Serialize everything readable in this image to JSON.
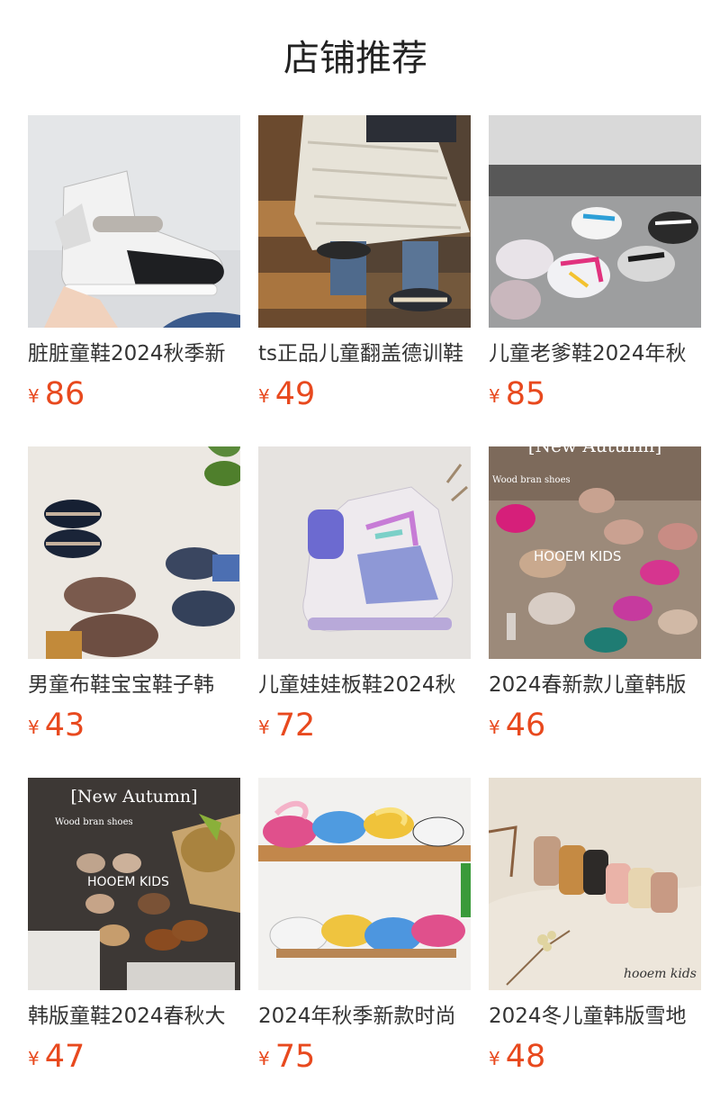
{
  "section": {
    "title": "店铺推荐"
  },
  "colors": {
    "price": "#e8491e",
    "text": "#333333"
  },
  "products": [
    {
      "name": "脏脏童鞋2024秋季新",
      "currency": "¥",
      "price": "86",
      "image": "high-top-sneaker-photo"
    },
    {
      "name": "ts正品儿童翻盖德训鞋",
      "currency": "¥",
      "price": "49",
      "image": "child-on-stairs-photo"
    },
    {
      "name": "儿童老爹鞋2024年秋",
      "currency": "¥",
      "price": "85",
      "image": "chunky-sneakers-photo"
    },
    {
      "name": "男童布鞋宝宝鞋子韩",
      "currency": "¥",
      "price": "43",
      "image": "cloth-shoes-photo"
    },
    {
      "name": "儿童娃娃板鞋2024秋",
      "currency": "¥",
      "price": "72",
      "image": "purple-board-shoe-photo"
    },
    {
      "name": "2024春新款儿童韩版",
      "currency": "¥",
      "price": "46",
      "image": "clog-slippers-photo",
      "overlay": {
        "headline": "[New Autumn]",
        "sub": "Wood bran shoes",
        "brand": "HOOEM  KIDS"
      }
    },
    {
      "name": "韩版童鞋2024春秋大",
      "currency": "¥",
      "price": "47",
      "image": "autumn-clogs-photo",
      "overlay": {
        "headline": "[New Autumn]",
        "sub": "Wood bran shoes",
        "brand": "HOOEM  KIDS"
      }
    },
    {
      "name": "2024年秋季新款时尚",
      "currency": "¥",
      "price": "75",
      "image": "lace-sneakers-photo"
    },
    {
      "name": "2024冬儿童韩版雪地",
      "currency": "¥",
      "price": "48",
      "image": "snow-boots-photo",
      "overlay": {
        "brand": "hooem  kids"
      }
    }
  ]
}
